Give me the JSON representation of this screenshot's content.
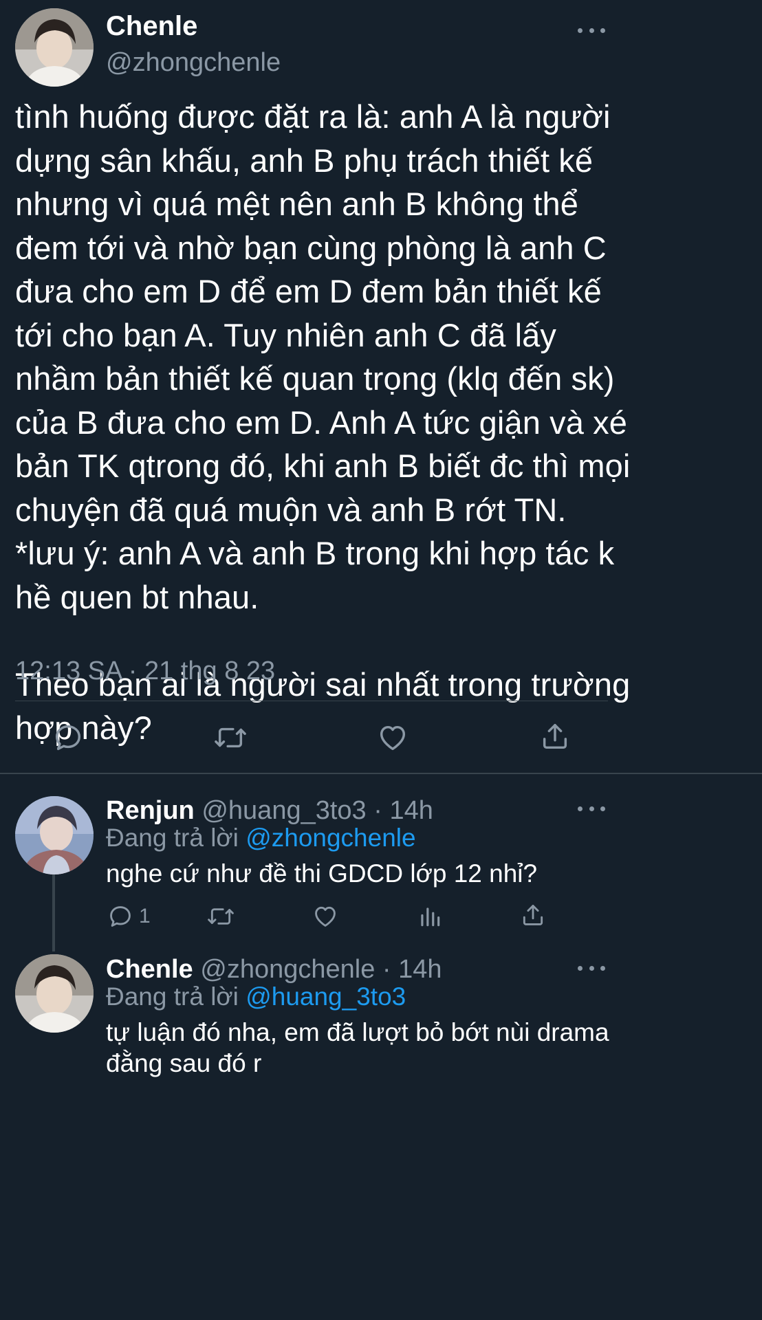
{
  "main_tweet": {
    "author_name": "Chenle",
    "author_handle": "@zhongchenle",
    "text": "tình huống được đặt ra là: anh A là người\ndựng sân khấu, anh B phụ trách thiết kế\nnhưng vì quá mệt nên anh B không thể\nđem tới và nhờ bạn cùng phòng là anh C\nđưa cho em D để em D đem bản thiết kế\ntới cho bạn A. Tuy nhiên anh C đã lấy\nnhầm bản thiết kế quan trọng (klq đến sk)\ncủa B đưa cho em D. Anh A tức giận và xé\nbản TK qtrong đó, khi anh B biết đc thì mọi\nchuyện đã quá muộn và anh B rớt TN.\n*lưu ý: anh A và anh B trong khi hợp tác k\nhề quen bt nhau.\n\nTheo bạn ai là người sai nhất trong trường\nhợp này?",
    "timestamp": "12:13 SA · 21 thg 8 23",
    "actions": [
      "reply-icon",
      "retweet-icon",
      "like-icon",
      "share-icon"
    ]
  },
  "replies": [
    {
      "author_name": "Renjun",
      "author_handle": "@huang_3to3",
      "time": " · 14h",
      "replying_prefix": "Đang trả lời ",
      "replying_to": "@zhongchenle",
      "text": "nghe cứ như đề thi GDCD lớp 12 nhỉ?",
      "reply_count": "1"
    },
    {
      "author_name": "Chenle",
      "author_handle": "@zhongchenle",
      "time": " · 14h",
      "replying_prefix": "Đang trả lời ",
      "replying_to": "@huang_3to3",
      "text": "tự luận đó nha, em đã lượt bỏ bớt nùi drama\nđằng sau đó r"
    }
  ],
  "colors": {
    "background": "#15202b",
    "text_primary": "#ffffff",
    "text_secondary": "#8b98a5",
    "accent": "#1d9bf0",
    "divider": "#38444d"
  }
}
